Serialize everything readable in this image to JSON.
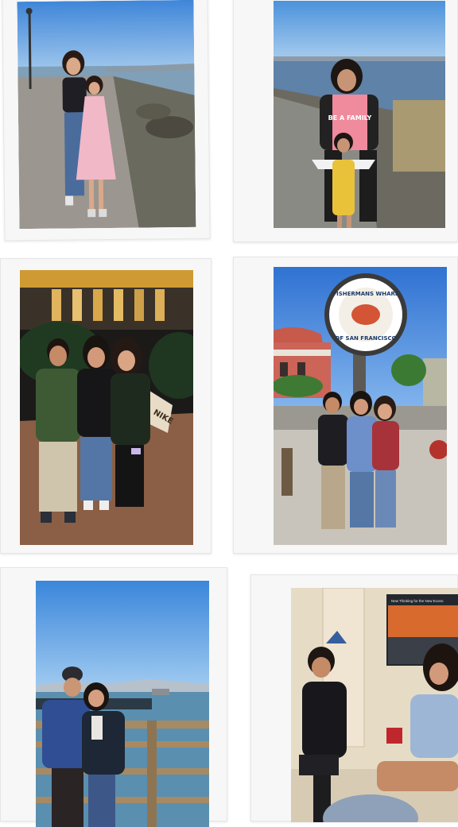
{
  "photos": [
    {
      "id": "waterfront-path",
      "scene": "two girls posing on a shoreline gravel path by the bay"
    },
    {
      "id": "shirt-duo",
      "scene": "girl in pink shirt with child in yellow dress by the water"
    },
    {
      "id": "night-group",
      "scene": "three friends at night in front of a lit building"
    },
    {
      "id": "fishermans-wharf",
      "scene": "group posing under the Fisherman's Wharf sign"
    },
    {
      "id": "pier-couple",
      "scene": "couple on a pier with the bay and island behind"
    },
    {
      "id": "indoor-hangout",
      "scene": "friends sitting and talking indoors"
    }
  ],
  "texts": {
    "tshirt": "BE A FAMILY",
    "wharf_sign_top": "FISHERMANS WHARF",
    "wharf_sign_bottom": "OF SAN FRANCISCO",
    "nike_sign": "NIKE",
    "poster_caption": "New Thinking for the New Econo"
  },
  "colors": {
    "background": "#ffffff",
    "frame": "#f7f7f7",
    "sky": "#4f8fd6",
    "water": "#6b8fb0",
    "sign_red": "#c23a2b"
  }
}
